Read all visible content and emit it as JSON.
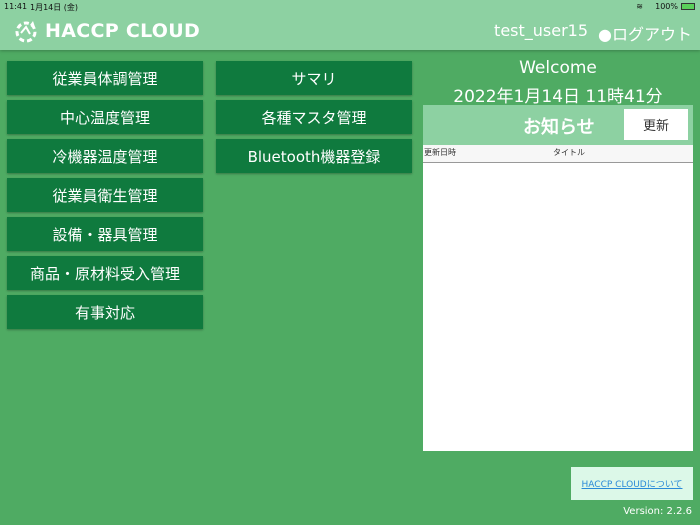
{
  "status_bar": {
    "time": "11:41",
    "date": "1月14日 (金)",
    "battery": "100%"
  },
  "header": {
    "logo": "HACCP CLOUD",
    "username": "test_user15",
    "logout": "●ログアウト"
  },
  "menu_left": [
    "従業員体調管理",
    "中心温度管理",
    "冷機器温度管理",
    "従業員衛生管理",
    "設備・器具管理",
    "商品・原材料受入管理",
    "有事対応"
  ],
  "menu_right": [
    "サマリ",
    "各種マスタ管理",
    "Bluetooth機器登録"
  ],
  "welcome": {
    "title": "Welcome",
    "datetime": "2022年1月14日 11時41分"
  },
  "notices": {
    "title": "お知らせ",
    "refresh": "更新",
    "columns": [
      "更新日時",
      "タイトル"
    ]
  },
  "footer": {
    "about": "HACCP CLOUDについて",
    "version": "Version: 2.2.6"
  }
}
